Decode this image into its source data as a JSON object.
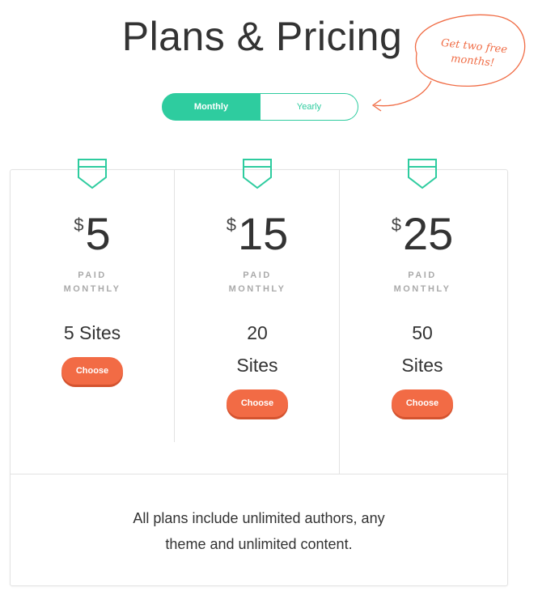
{
  "header": {
    "title": "Plans & Pricing"
  },
  "billing_toggle": {
    "options": [
      {
        "label": "Monthly",
        "selected": true
      },
      {
        "label": "Yearly",
        "selected": false
      }
    ]
  },
  "callout": {
    "line1": "Get two free",
    "line2": "months!"
  },
  "plans": [
    {
      "currency": "$",
      "amount": "5",
      "billing_line1": "PAID",
      "billing_line2": "MONTHLY",
      "sites_line1": "5 Sites",
      "sites_line2": "",
      "button": "Choose"
    },
    {
      "currency": "$",
      "amount": "15",
      "billing_line1": "PAID",
      "billing_line2": "MONTHLY",
      "sites_line1": "20",
      "sites_line2": "Sites",
      "button": "Choose"
    },
    {
      "currency": "$",
      "amount": "25",
      "billing_line1": "PAID",
      "billing_line2": "MONTHLY",
      "sites_line1": "50",
      "sites_line2": "Sites",
      "button": "Choose"
    }
  ],
  "footer": {
    "line1": "All plans include unlimited authors, any",
    "line2": "theme and unlimited content."
  },
  "colors": {
    "accent_green": "#2ecc9f",
    "button_orange": "#f26b45",
    "callout_orange": "#f06c45"
  },
  "icons": [
    "shield-icon",
    "curved-arrow-icon"
  ]
}
